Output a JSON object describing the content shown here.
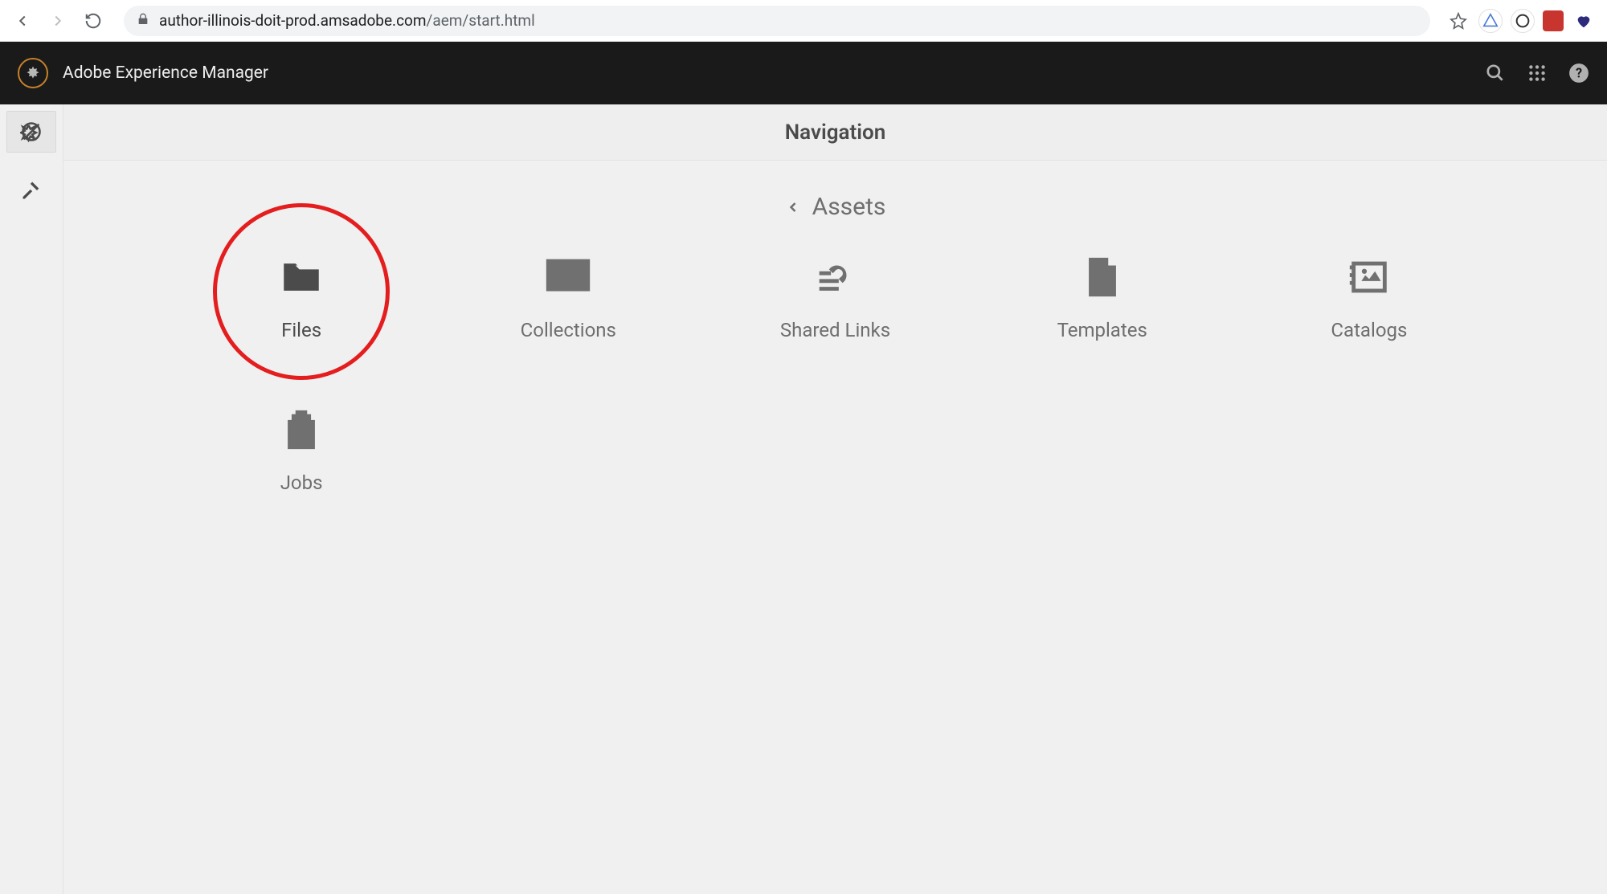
{
  "browser": {
    "url_domain": "author-illinois-doit-prod.amsadobe.com",
    "url_path": "/aem/start.html"
  },
  "header": {
    "product_name": "Adobe Experience Manager"
  },
  "panel": {
    "title": "Navigation",
    "breadcrumb": "Assets"
  },
  "nav_items": [
    {
      "label": "Files",
      "highlighted": true
    },
    {
      "label": "Collections"
    },
    {
      "label": "Shared Links"
    },
    {
      "label": "Templates"
    },
    {
      "label": "Catalogs"
    },
    {
      "label": "Jobs"
    }
  ]
}
